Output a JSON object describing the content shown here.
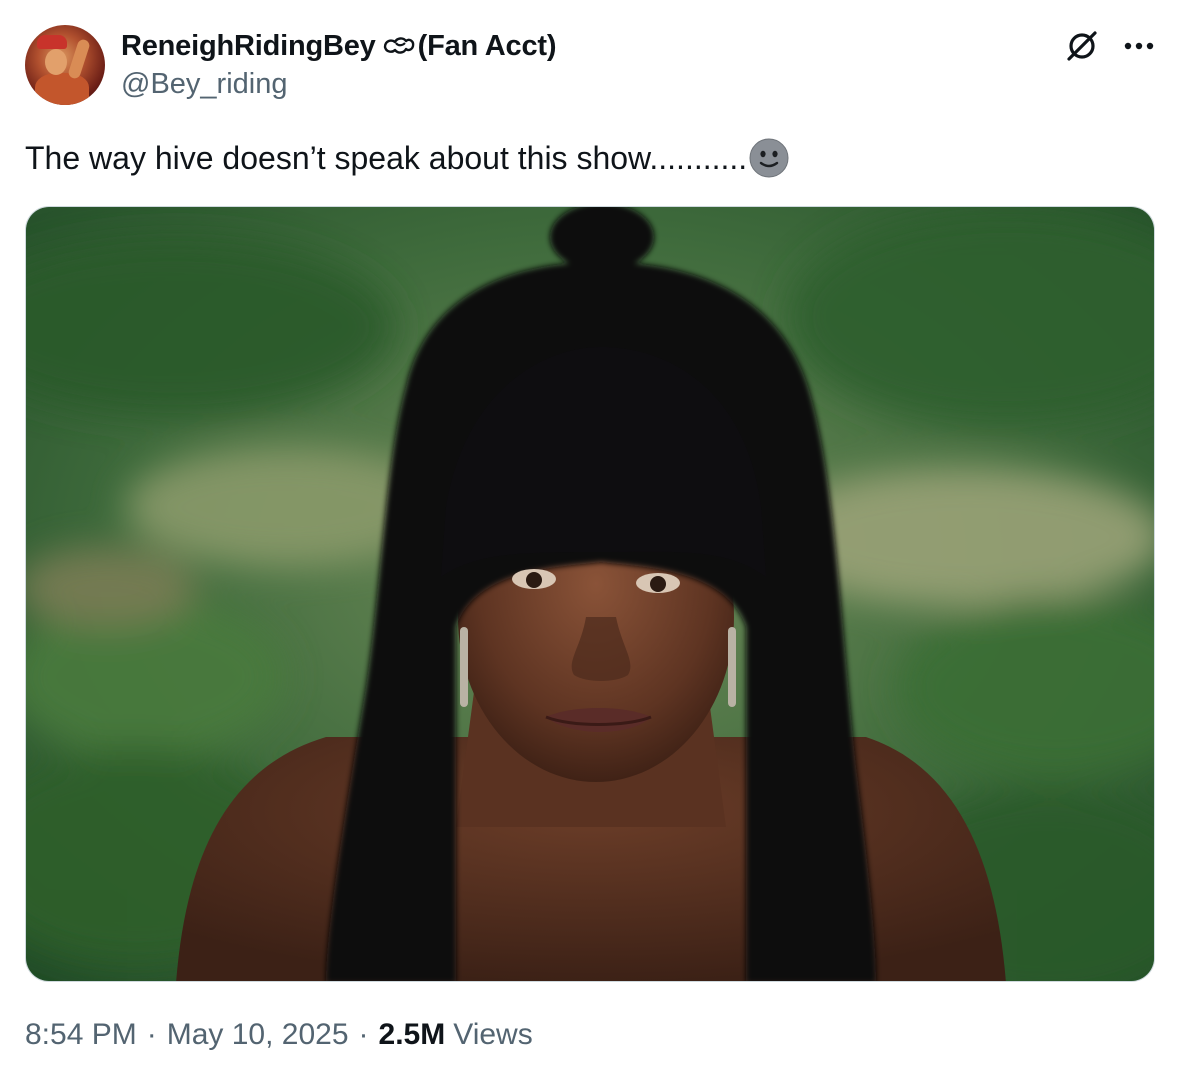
{
  "author": {
    "display_name": "ReneighRidingBey",
    "name_suffix": "(Fan Acct)",
    "name_emoji": "horse-saddle-icon",
    "handle": "@Bey_riding",
    "avatar": "avatar-image"
  },
  "header_icons": {
    "grok": "grok-icon",
    "more": "more-icon"
  },
  "tweet": {
    "text": "The way hive doesn’t speak about this show...........",
    "trailing_emoji": "slightly-smiling-face-icon"
  },
  "media": {
    "type": "photo",
    "label": "tweet-photo"
  },
  "meta": {
    "time": "8:54 PM",
    "separator": "·",
    "date": "May 10, 2025",
    "views_count": "2.5M",
    "views_label": "Views"
  },
  "colors": {
    "text_primary": "#0f1419",
    "text_secondary": "#536471",
    "border": "#cfd9de"
  }
}
